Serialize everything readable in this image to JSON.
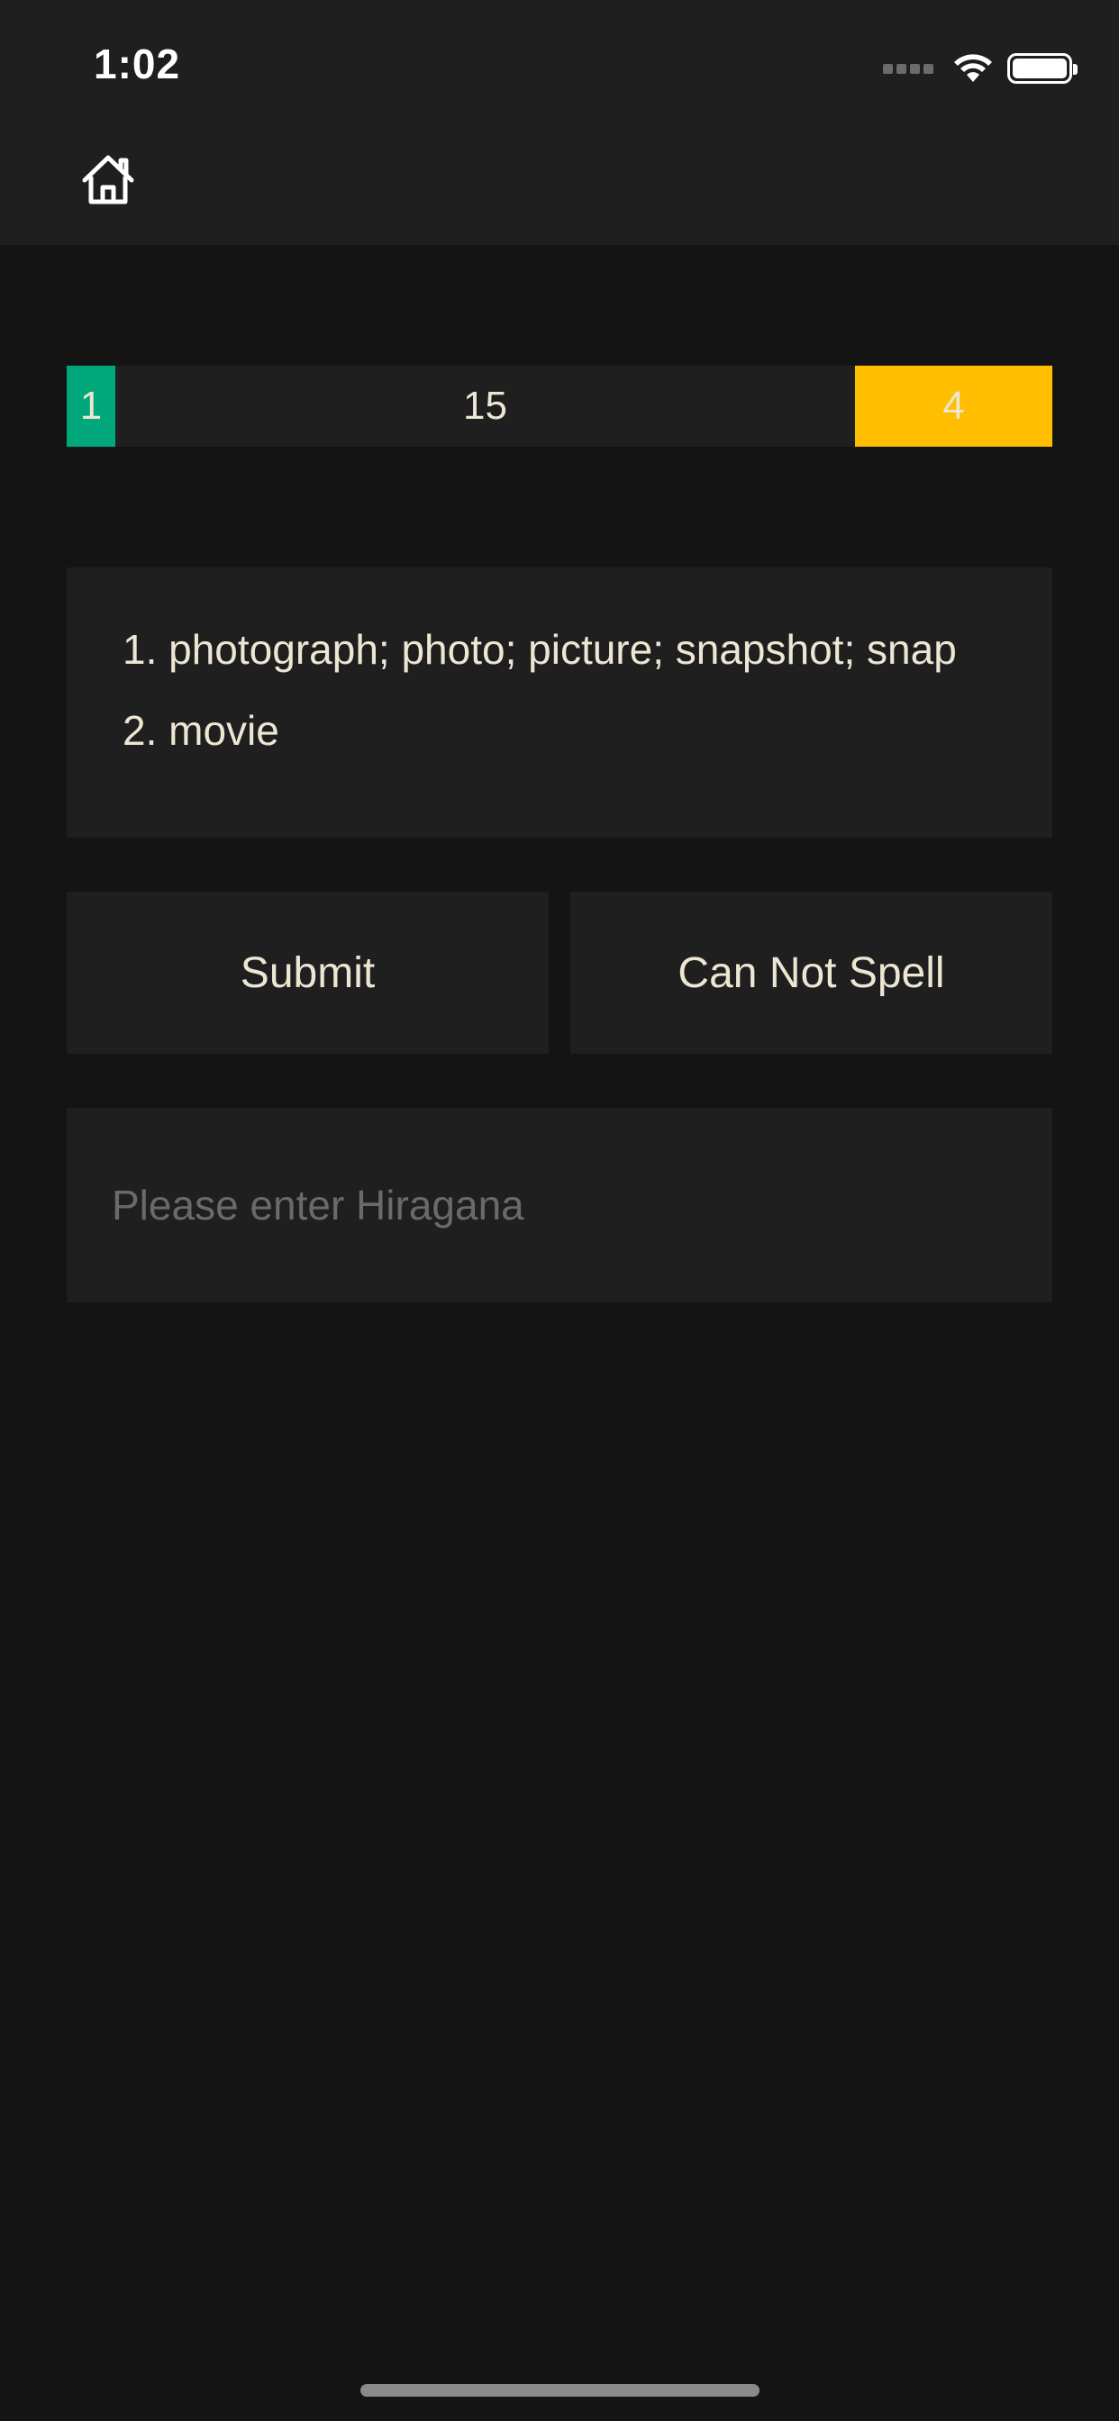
{
  "status_bar": {
    "time": "1:02",
    "icons": [
      "signal-icon",
      "wifi-icon",
      "battery-icon"
    ]
  },
  "nav": {
    "home_icon": "home-icon"
  },
  "progress": {
    "correct": "1",
    "remaining": "15",
    "wrong": "4",
    "colors": {
      "correct": "#00a77a",
      "remaining": "#1f1f1f",
      "wrong": "#ffbe00"
    }
  },
  "meanings": [
    "1. photograph; photo; picture; snapshot; snap",
    "2. movie"
  ],
  "actions": {
    "submit_label": "Submit",
    "cannot_spell_label": "Can Not Spell"
  },
  "answer": {
    "value": "",
    "placeholder": "Please enter Hiragana"
  },
  "colors": {
    "background": "#141414",
    "surface": "#1f1f1f",
    "text": "#ece6d3",
    "placeholder": "#6a6a6a"
  }
}
